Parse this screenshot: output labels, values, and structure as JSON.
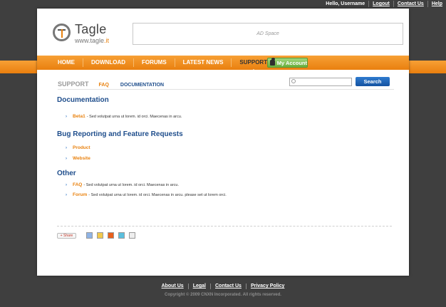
{
  "topbar": {
    "greeting": "Hello, Username",
    "logout": "Logout",
    "contact": "Contact Us",
    "help": "Help"
  },
  "logo": {
    "name": "Tagle",
    "url_prefix": "www.tagle",
    "url_tld": ".it"
  },
  "ad": {
    "label": "AD Space"
  },
  "nav": {
    "items": [
      "HOME",
      "DOWNLOAD",
      "FORUMS",
      "LATEST NEWS",
      "SUPPORT"
    ],
    "active": "SUPPORT",
    "my_account": "My Account"
  },
  "subnav": {
    "section": "SUPPORT",
    "items": [
      "FAQ",
      "DOCUMENTATION"
    ]
  },
  "search": {
    "placeholder": "",
    "button": "Search"
  },
  "sections": {
    "documentation": {
      "title": "Documentation",
      "items": [
        {
          "link": "Beta1",
          "text": "- Sed volutpat urna ut lorem. id orci. Maecenas in arcu."
        }
      ]
    },
    "bugs": {
      "title": "Bug Reporting and Feature Requests",
      "items": [
        {
          "link": "Product"
        },
        {
          "link": "Website"
        }
      ]
    },
    "other": {
      "title": "Other",
      "items": [
        {
          "link": "FAQ",
          "text": "- Sed volutpat urna ut lorem. id orci. Maecenas in arcu."
        },
        {
          "link": "Forum",
          "text": "- Sed volutpat urna ut lorem. id orci. Maecenas in arcu. please set ut lorem orci."
        }
      ]
    }
  },
  "share": {
    "label": "+ Share"
  },
  "social_colors": [
    "#8fb4e6",
    "#f2c94c",
    "#e8601c",
    "#5bc0de",
    "#eeeeee"
  ],
  "footer": {
    "links": [
      "About Us",
      "Legal",
      "Contact Us",
      "Privacy Policy"
    ],
    "copyright": "Copyright © 2009 CNXN Incorporated. All rights reserved."
  },
  "colors": {
    "accent": "#e9820f",
    "heading": "#1f4e8c",
    "background": "#3f3f3f"
  }
}
